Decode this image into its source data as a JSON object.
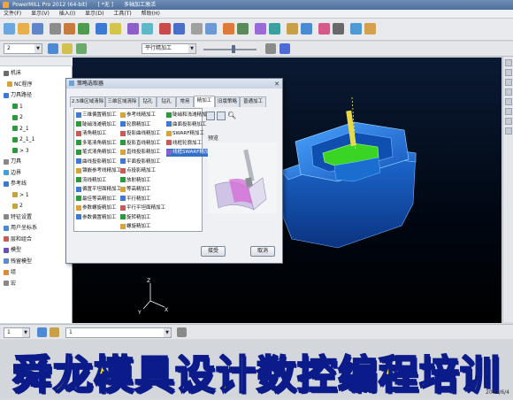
{
  "window": {
    "title": "PowerMILL Pro 2012 (64-bit)",
    "project": "[ *无 ]",
    "mode": "多轴加工激活"
  },
  "menu": [
    "文件(F)",
    "显示(V)",
    "插入(I)",
    "显示(D)",
    "工具(T)",
    "帮助(H)"
  ],
  "toolbar": {
    "combo_left": "2",
    "combo_strategy": "平行精加工"
  },
  "tree": {
    "items": [
      {
        "label": "机床",
        "color": "#6c6c6c"
      },
      {
        "label": "NC程序",
        "color": "#d9a23a"
      },
      {
        "label": "刀具路径",
        "color": "#3d7ad6"
      },
      {
        "label": "1",
        "color": "#2a9a3c"
      },
      {
        "label": "2",
        "color": "#2a9a3c"
      },
      {
        "label": "2_1",
        "color": "#2a9a3c"
      },
      {
        "label": "2_1_1",
        "color": "#2a9a3c"
      },
      {
        "label": "> 3",
        "color": "#2a9a3c"
      },
      {
        "label": "刀具",
        "color": "#888"
      },
      {
        "label": "边界",
        "color": "#3da0d8"
      },
      {
        "label": "参考线",
        "color": "#3d7ad6"
      },
      {
        "label": "> 1",
        "color": "#c8a23a"
      },
      {
        "label": "2",
        "color": "#c8a23a"
      },
      {
        "label": "特征设置",
        "color": "#888"
      },
      {
        "label": "用户坐标系",
        "color": "#4a8ad2"
      },
      {
        "label": "层和组合",
        "color": "#c85a5a"
      },
      {
        "label": "模型",
        "color": "#6b4fb8"
      },
      {
        "label": "残留模型",
        "color": "#5a8ad2"
      },
      {
        "label": "组",
        "color": "#d98a3a"
      },
      {
        "label": "宏",
        "color": "#888"
      }
    ]
  },
  "dialog": {
    "title": "策略选取器",
    "tabs": [
      "2.5维区域清除",
      "三维区域清除",
      "钻孔",
      "钻孔",
      "常用",
      "精加工",
      "旧版策略",
      "普通加工"
    ],
    "active_tab": "精加工",
    "list_col1": [
      "三维偏置精加工",
      "陡峭浅滩精加工",
      "清角精加工",
      "多笔清角精加工",
      "笔式清角精加工",
      "曲线投影精加工",
      "镶嵌参考线精加工",
      "流线精加工",
      "偏置平坦面精加工",
      "最佳等高精加工",
      "参数螺旋精加工",
      "参数偏置精加工"
    ],
    "list_col2": [
      "参考线精加工",
      "轮廓精加工",
      "投影曲线精加工",
      "投影直线精加工",
      "直线投影精加工",
      "平面投影精加工",
      "点投影精加工",
      "放射精加工",
      "等高精加工",
      "平行精加工",
      "平行平坦面精加工",
      "旋转精加工",
      "螺旋精加工"
    ],
    "list_col3": [
      "陡峭和浅滩精加工",
      "曲面投影精加工",
      "SWARF精加工",
      "线框轮廓加工",
      "线框SWARF精加工"
    ],
    "selected_item": "线框SWARF精加工",
    "preview_label": "预览",
    "ok_label": "接受",
    "cancel_label": "取消"
  },
  "status": {
    "value": "1"
  },
  "banner": {
    "text": "舜龙模具设计数控编程培训"
  },
  "clock": "2012/6/4",
  "colors": {
    "part": "#1e6fd8",
    "highlight": "#39d424",
    "banner_text": "#f6e600",
    "banner_outline": "#0b1b8a"
  }
}
